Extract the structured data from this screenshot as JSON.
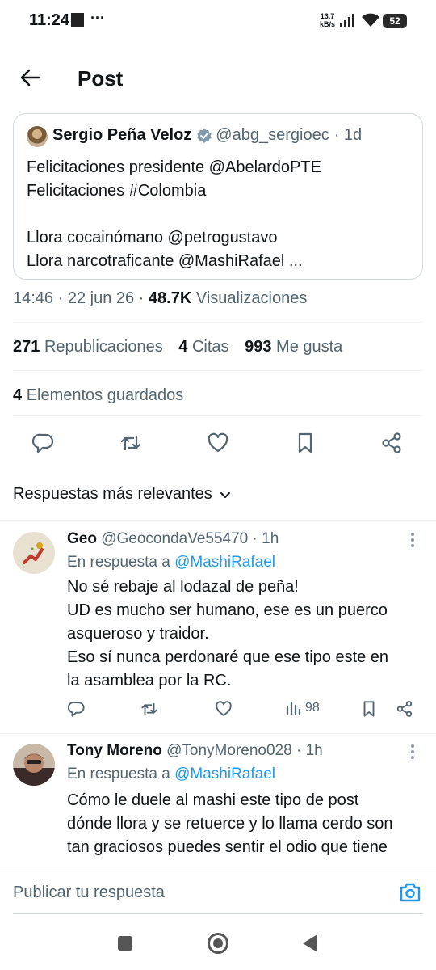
{
  "status_bar": {
    "time": "11:24",
    "dots": "···",
    "speed_value": "13.7",
    "speed_unit": "kB/s",
    "battery": "52"
  },
  "header": {
    "title": "Post"
  },
  "quoted_post": {
    "name": "Sergio Peña Veloz",
    "handle": "@abg_sergioec",
    "time": "· 1d",
    "lines": [
      "Felicitaciones presidente @AbelardoPTE",
      "Felicitaciones #Colombia",
      "",
      "Llora cocainómano @petrogustavo",
      "Llora narcotraficante @MashiRafael  ..."
    ]
  },
  "meta": {
    "time": "14:46 · 22 jun 26 ·",
    "views_count": "48.7K",
    "views_label": "Visualizaciones"
  },
  "stats": {
    "reposts_count": "271",
    "reposts_label": "Republicaciones",
    "quotes_count": "4",
    "quotes_label": "Citas",
    "likes_count": "993",
    "likes_label": "Me gusta",
    "saved_count": "4",
    "saved_label": "Elementos guardados"
  },
  "replies_sort": {
    "label": "Respuestas más relevantes"
  },
  "replies": [
    {
      "name": "Geo",
      "handle": "@GeocondaVe55470",
      "time": "· 1h",
      "reply_prefix": "En respuesta a",
      "reply_to": "@MashiRafael",
      "lines": [
        "No sé rebaje al lodazal de peña!",
        "UD es mucho ser humano, ese es un puerco",
        "asqueroso y traidor.",
        "Eso sí nunca perdonaré que ese tipo este en",
        "la asamblea por la RC."
      ],
      "views": "98"
    },
    {
      "name": "Tony Moreno",
      "handle": "@TonyMoreno028",
      "time": "· 1h",
      "reply_prefix": "En respuesta a",
      "reply_to": "@MashiRafael",
      "lines": [
        "Cómo le duele al mashi este tipo de post",
        "dónde llora y se retuerce y lo llama cerdo son",
        "tan graciosos puedes sentir el odio que tiene"
      ]
    }
  ],
  "composer": {
    "placeholder": "Publicar tu respuesta"
  },
  "colors": {
    "accent": "#1d9bf0",
    "muted": "#536471",
    "text": "#0f1419"
  }
}
